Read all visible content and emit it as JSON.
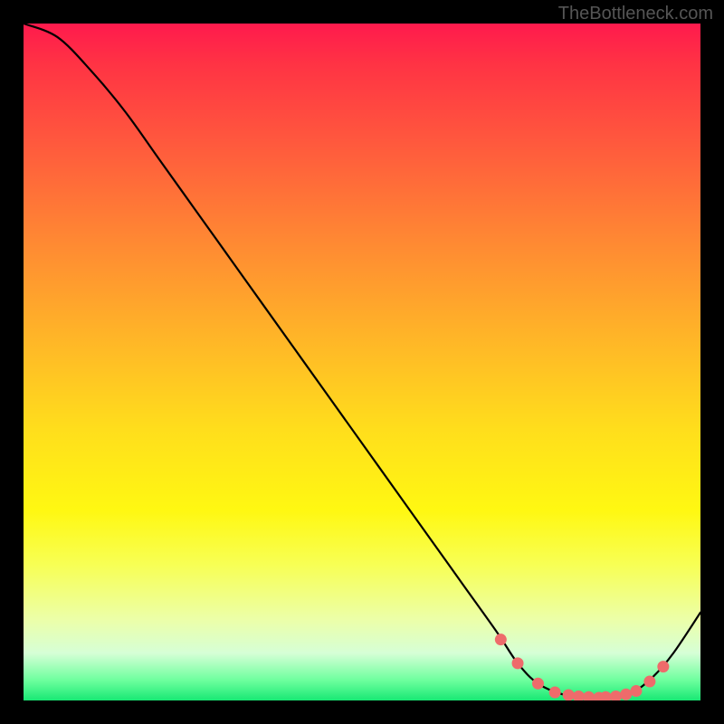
{
  "watermark": "TheBottleneck.com",
  "chart_data": {
    "type": "line",
    "title": "",
    "xlabel": "",
    "ylabel": "",
    "xlim": [
      0,
      100
    ],
    "ylim": [
      0,
      100
    ],
    "series": [
      {
        "name": "bottleneck-curve",
        "x": [
          0,
          5,
          10,
          15,
          20,
          25,
          30,
          35,
          40,
          45,
          50,
          55,
          60,
          65,
          70,
          73,
          76,
          80,
          84,
          87,
          90,
          93,
          96,
          100
        ],
        "values": [
          100,
          98,
          93,
          87,
          80,
          73,
          66,
          59,
          52,
          45,
          38,
          31,
          24,
          17,
          10,
          5.5,
          2.5,
          0.8,
          0.4,
          0.5,
          1.2,
          3.5,
          7,
          13
        ]
      }
    ],
    "markers": {
      "name": "highlight-dots",
      "color": "#ee6b6b",
      "x": [
        70.5,
        73,
        76,
        78.5,
        80.5,
        82,
        83.5,
        85,
        86,
        87.5,
        89,
        90.5,
        92.5,
        94.5
      ],
      "values": [
        9.0,
        5.5,
        2.5,
        1.2,
        0.8,
        0.6,
        0.5,
        0.4,
        0.5,
        0.6,
        0.9,
        1.4,
        2.8,
        5.0
      ]
    },
    "background_gradient": {
      "type": "vertical",
      "stops": [
        {
          "pos": 0.0,
          "color": "#ff1a4d"
        },
        {
          "pos": 0.3,
          "color": "#ff8833"
        },
        {
          "pos": 0.6,
          "color": "#ffde1c"
        },
        {
          "pos": 0.85,
          "color": "#f4ff80"
        },
        {
          "pos": 1.0,
          "color": "#18e874"
        }
      ]
    }
  }
}
